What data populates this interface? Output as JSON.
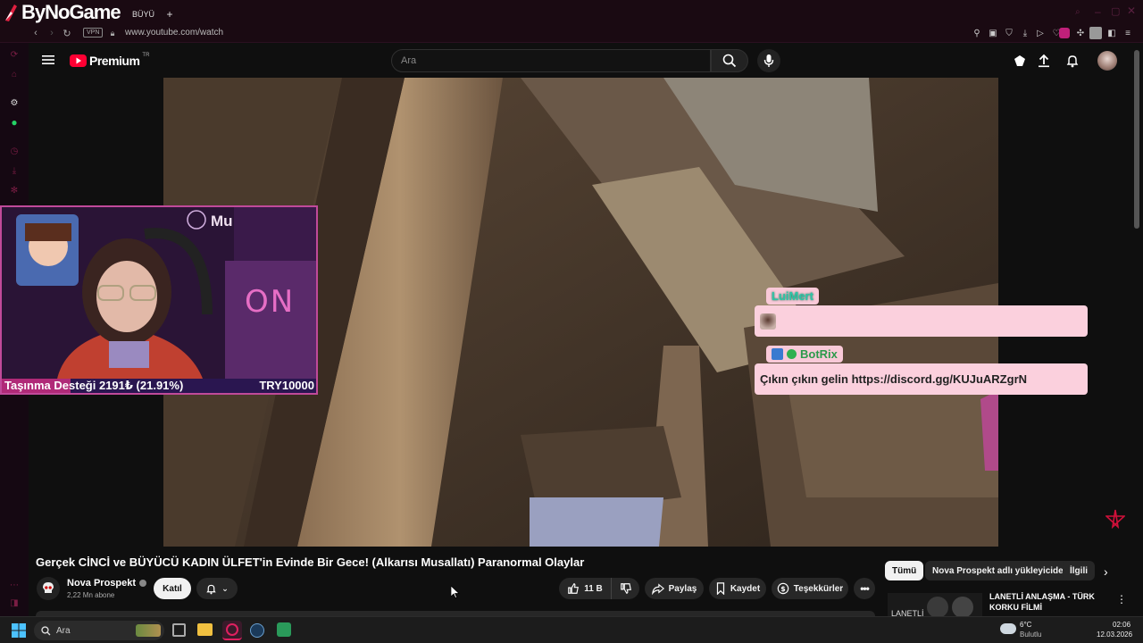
{
  "browser": {
    "brand": "ByNoGame",
    "tab_label": "BÜYÜ",
    "new_tab": "+",
    "vpn_badge": "VPN",
    "url": "www.youtube.com/watch"
  },
  "youtube": {
    "logo_text": "Premium",
    "logo_region": "TR",
    "search_placeholder": "Ara"
  },
  "overlay": {
    "webcam_tag": "Mu",
    "neon_text": "ON",
    "donation_label": "Taşınma Desteği 2191₺ (21.91%)",
    "donation_code": "TRY10000",
    "donation_progress": 0.2191,
    "chat": [
      {
        "user": "LuiMert",
        "message": ""
      },
      {
        "user": "BotRix",
        "message": "Çıkın çıkın gelin https://discord.gg/KUJuARZgrN"
      }
    ]
  },
  "video": {
    "title": "Gerçek CİNCİ ve BÜYÜCÜ KADIN ÜLFET'in Evinde Bir Gece! (Alkarısı Musallatı) Paranormal Olaylar",
    "channel_name": "Nova Prospekt",
    "subscribers": "2,22 Mn abone",
    "join_label": "Katıl",
    "likes": "11 B",
    "share_label": "Paylaş",
    "save_label": "Kaydet",
    "thanks_label": "Teşekkürler"
  },
  "filters": {
    "chips": [
      "Tümü",
      "Nova Prospekt adlı yükleyiciden",
      "İlgili"
    ]
  },
  "recommended": {
    "title": "LANETLİ ANLAŞMA - TÜRK KORKU FİLMİ",
    "thumb_text": "LANETLİ"
  },
  "taskbar": {
    "search_placeholder": "Ara",
    "weather_temp": "6°C",
    "weather_desc": "Bulutlu",
    "time": "02:06",
    "date": "12.03.2026"
  },
  "colors": {
    "accent": "#ff0033",
    "chat_bg": "#fbd0dd",
    "luimert_name": "#2ec4a6",
    "botrix_name": "#2b9a4b",
    "webcam_border": "#c04a9a"
  }
}
